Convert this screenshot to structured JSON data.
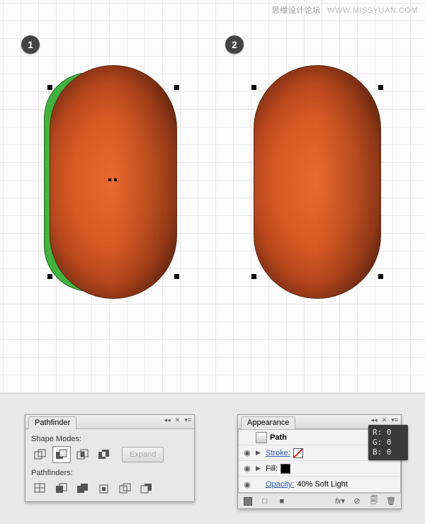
{
  "watermark": {
    "cn": "思缘设计论坛",
    "url": "WWW.MISSYUAN.COM"
  },
  "steps": {
    "one": "1",
    "two": "2"
  },
  "pathfinder": {
    "title": "Pathfinder",
    "shape_modes_label": "Shape Modes:",
    "expand_label": "Expand",
    "pathfinders_label": "Pathfinders:"
  },
  "appearance": {
    "title": "Appearance",
    "path_label": "Path",
    "stroke_label": "Stroke:",
    "fill_label": "Fill:",
    "opacity_label": "Opacity:",
    "opacity_value": "40% Soft Light"
  },
  "rgb": {
    "r": "R: 0",
    "g": "G: 0",
    "b": "B: 0"
  }
}
